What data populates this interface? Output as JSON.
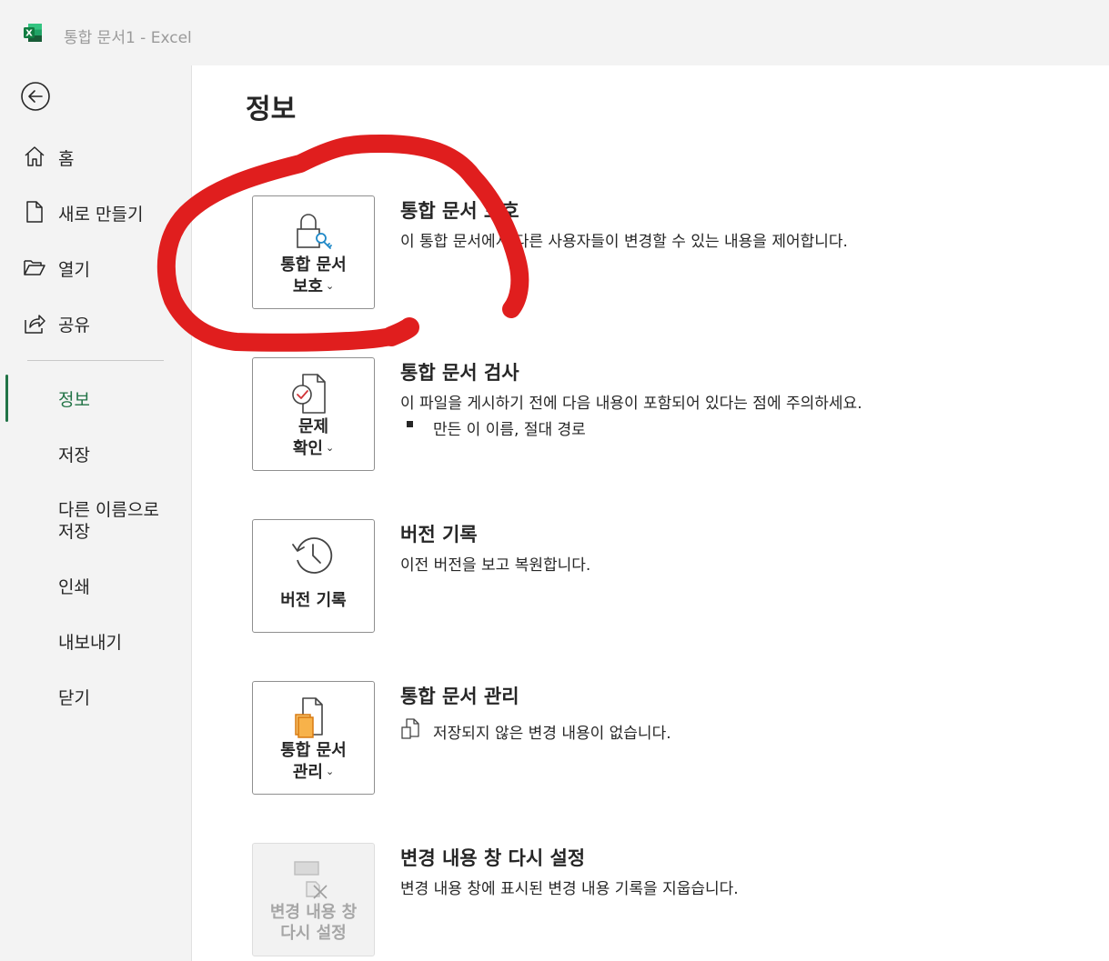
{
  "titlebar": {
    "app_icon": "excel-logo-icon",
    "title": "통합 문서1  -  Excel"
  },
  "nav": {
    "back_icon": "back-arrow-icon",
    "items": [
      {
        "label": "홈",
        "icon": "home-icon"
      },
      {
        "label": "새로 만들기",
        "icon": "new-document-icon"
      },
      {
        "label": "열기",
        "icon": "open-folder-icon"
      },
      {
        "label": "공유",
        "icon": "share-icon"
      }
    ],
    "text_items": [
      {
        "label": "정보",
        "active": true
      },
      {
        "label": "저장"
      },
      {
        "label": "다른 이름으로 저장"
      },
      {
        "label": "인쇄"
      },
      {
        "label": "내보내기"
      },
      {
        "label": "닫기"
      }
    ],
    "accent_color": "#217346"
  },
  "page": {
    "title": "정보"
  },
  "sections": {
    "protect": {
      "tile_label_1": "통합 문서",
      "tile_label_2": "보호",
      "icon": "lock-key-icon",
      "title": "통합 문서 보호",
      "desc": "이 통합 문서에서 다른 사용자들이 변경할 수 있는 내용을 제어합니다."
    },
    "inspect": {
      "tile_label_1": "문제",
      "tile_label_2": "확인",
      "icon": "document-check-icon",
      "title": "통합 문서 검사",
      "desc": "이 파일을 게시하기 전에 다음 내용이 포함되어 있다는 점에 주의하세요.",
      "bullet": "만든 이 이름, 절대 경로"
    },
    "history": {
      "tile_label_1": "버전 기록",
      "icon": "history-clock-icon",
      "title": "버전 기록",
      "desc": "이전 버전을 보고 복원합니다."
    },
    "manage": {
      "tile_label_1": "통합 문서",
      "tile_label_2": "관리",
      "icon": "manage-documents-icon",
      "title": "통합 문서 관리",
      "desc": "저장되지 않은 변경 내용이 없습니다."
    },
    "reset": {
      "tile_label_1": "변경 내용 창",
      "tile_label_2": "다시 설정",
      "icon": "reset-pane-icon",
      "title": "변경 내용 창 다시 설정",
      "desc": "변경 내용 창에 표시된 변경 내용 기록을 지웁습니다."
    }
  },
  "annotation": {
    "color": "#e01e1e",
    "shape": "red-freehand-circle"
  }
}
